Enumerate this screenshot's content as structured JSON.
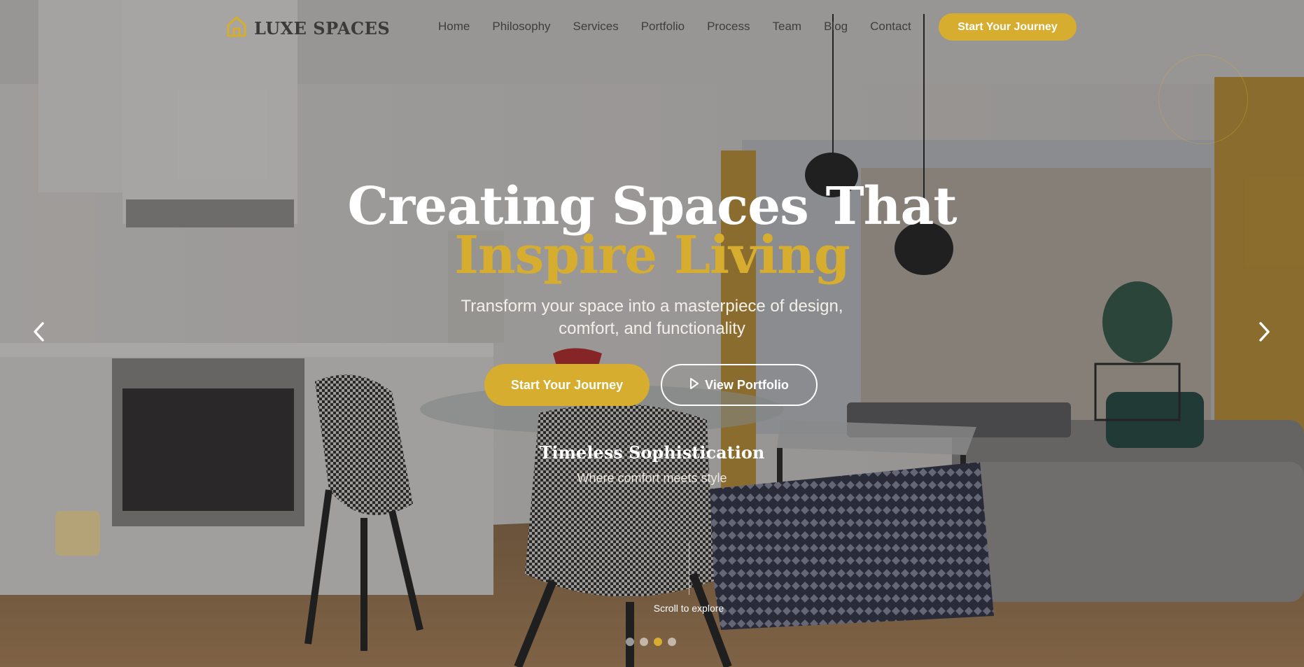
{
  "brand": {
    "name": "LUXE SPACES",
    "accent": "#d6ad2e"
  },
  "nav": {
    "items": [
      "Home",
      "Philosophy",
      "Services",
      "Portfolio",
      "Process",
      "Team",
      "Blog",
      "Contact"
    ],
    "cta": "Start Your Journey"
  },
  "hero": {
    "title_line1": "Creating Spaces That",
    "title_line2": "Inspire Living",
    "subtitle_line1": "Transform your space into a masterpiece of design,",
    "subtitle_line2": "comfort, and functionality",
    "primary_button": "Start Your Journey",
    "secondary_button": "View Portfolio",
    "slide_title": "Timeless Sophistication",
    "slide_subtitle": "Where comfort meets style",
    "scroll_hint": "Scroll to explore"
  },
  "carousel": {
    "slide_count": 4,
    "active_index": 2
  },
  "icons": {
    "logo": "house-icon",
    "prev": "chevron-left-icon",
    "next": "chevron-right-icon",
    "play": "play-icon"
  }
}
